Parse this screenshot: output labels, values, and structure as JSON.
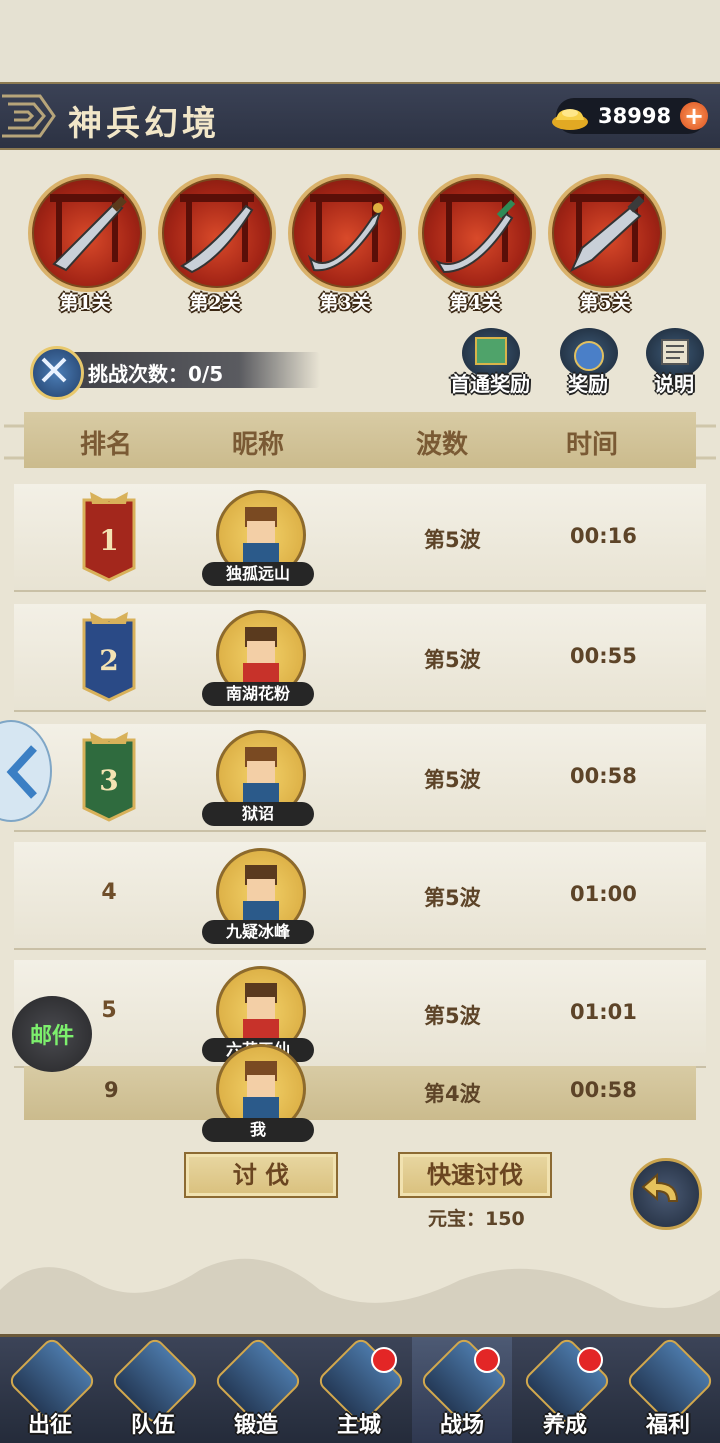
{
  "header": {
    "title": "神兵幻境",
    "currency_icon": "gold-ingot-icon",
    "currency_value": "38998",
    "add_icon": "plus-icon"
  },
  "stages": [
    {
      "label": "第1关"
    },
    {
      "label": "第2关"
    },
    {
      "label": "第3关"
    },
    {
      "label": "第4关"
    },
    {
      "label": "第5关"
    }
  ],
  "challenge": {
    "label": "挑战次数：0/5"
  },
  "top_buttons": {
    "first_clear": "首通奖励",
    "reward": "奖励",
    "help": "说明"
  },
  "table": {
    "headers": {
      "rank": "排名",
      "nickname": "昵称",
      "waves": "波数",
      "time": "时间"
    },
    "rows": [
      {
        "rank": "1",
        "name": "独孤远山",
        "waves": "第5波",
        "time": "00:16"
      },
      {
        "rank": "2",
        "name": "南湖花粉",
        "waves": "第5波",
        "time": "00:55"
      },
      {
        "rank": "3",
        "name": "狱诏",
        "waves": "第5波",
        "time": "00:58"
      },
      {
        "rank": "4",
        "name": "九疑冰峰",
        "waves": "第5波",
        "time": "01:00"
      },
      {
        "rank": "5",
        "name": "六花天仙",
        "waves": "第5波",
        "time": "01:01"
      }
    ],
    "mine": {
      "rank": "9",
      "name": "我",
      "waves": "第4波",
      "time": "00:58"
    }
  },
  "side": {
    "mail_label": "邮件"
  },
  "actions": {
    "attack": "讨 伐",
    "quick_attack": "快速讨伐",
    "cost": "元宝：150"
  },
  "colors": {
    "rank1": "#a3271c",
    "rank2": "#2a4a86",
    "rank3": "#2f6b3e",
    "accent_gold": "#d9b26b"
  },
  "nav": [
    {
      "label": "出征",
      "icon": "swords-icon",
      "badge": false
    },
    {
      "label": "队伍",
      "icon": "team-icon",
      "badge": false
    },
    {
      "label": "锻造",
      "icon": "forge-icon",
      "badge": false
    },
    {
      "label": "主城",
      "icon": "city-icon",
      "badge": true
    },
    {
      "label": "战场",
      "icon": "battlefield-icon",
      "badge": true,
      "active": true
    },
    {
      "label": "养成",
      "icon": "cultivate-icon",
      "badge": true
    },
    {
      "label": "福利",
      "icon": "welfare-icon",
      "badge": false
    }
  ]
}
